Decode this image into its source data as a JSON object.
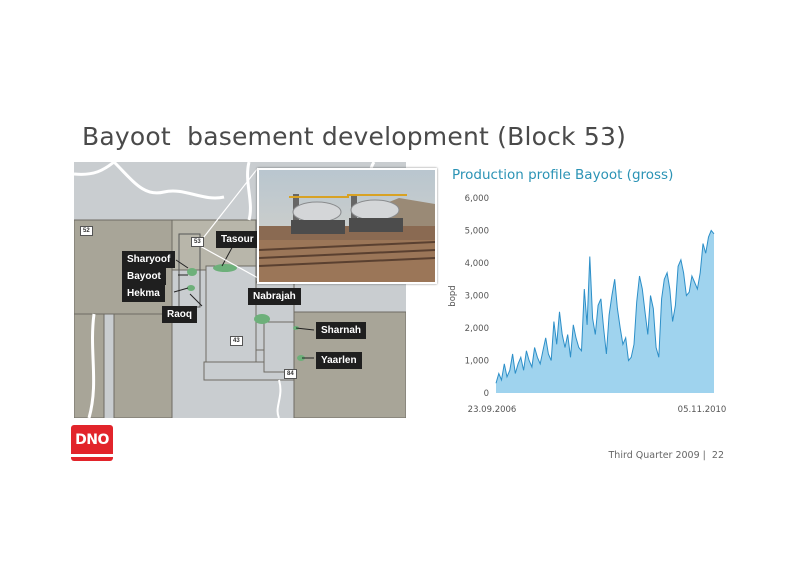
{
  "slide": {
    "title": "Bayoot  basement development (Block 53)",
    "footer_text": "Third Quarter 2009 |  22"
  },
  "logo": {
    "text": "DNO",
    "color": "#e2242b"
  },
  "map": {
    "field_labels": [
      "Tasour",
      "Sharyoof",
      "Bayoot",
      "Hekma",
      "Raoq",
      "Nabrajah",
      "Sharnah",
      "Yaarlen"
    ],
    "block_numbers": [
      "52",
      "53",
      "43",
      "84"
    ],
    "colors": {
      "land": "#c9cdd0",
      "concession": "#a8a598",
      "field": "#6db07a",
      "border": "#ffffff"
    }
  },
  "photo": {
    "icon": "production-facility-photo"
  },
  "chart_data": {
    "type": "area",
    "title": "Production profile Bayoot (gross)",
    "ylabel": "bopd",
    "xlabel": "",
    "x_tick_labels": [
      "23.09.2006",
      "05.11.2010"
    ],
    "y_ticks": [
      0,
      1000,
      2000,
      3000,
      4000,
      5000,
      6000
    ],
    "y_tick_labels": [
      "0",
      "1,000",
      "2,000",
      "3,000",
      "4,000",
      "5,000",
      "6,000"
    ],
    "ylim": [
      0,
      6000
    ],
    "grid": false,
    "fill_color": "#9fd3ee",
    "line_color": "#2d8fc8",
    "values": [
      300,
      600,
      400,
      900,
      500,
      700,
      1200,
      600,
      900,
      1100,
      700,
      1300,
      1000,
      800,
      1400,
      1100,
      900,
      1300,
      1700,
      1200,
      1000,
      2200,
      1500,
      2500,
      1800,
      1400,
      1800,
      1100,
      2100,
      1700,
      1400,
      1300,
      3200,
      2100,
      4200,
      2300,
      1800,
      2700,
      2900,
      2000,
      1200,
      2400,
      3000,
      3500,
      2600,
      2000,
      1500,
      1700,
      1000,
      1100,
      1500,
      2800,
      3600,
      3200,
      2500,
      1800,
      3000,
      2600,
      1400,
      1100,
      2900,
      3500,
      3700,
      3200,
      2200,
      2700,
      3900,
      4100,
      3700,
      3000,
      3100,
      3600,
      3400,
      3200,
      3700,
      4600,
      4300,
      4800,
      5000,
      4900
    ]
  }
}
